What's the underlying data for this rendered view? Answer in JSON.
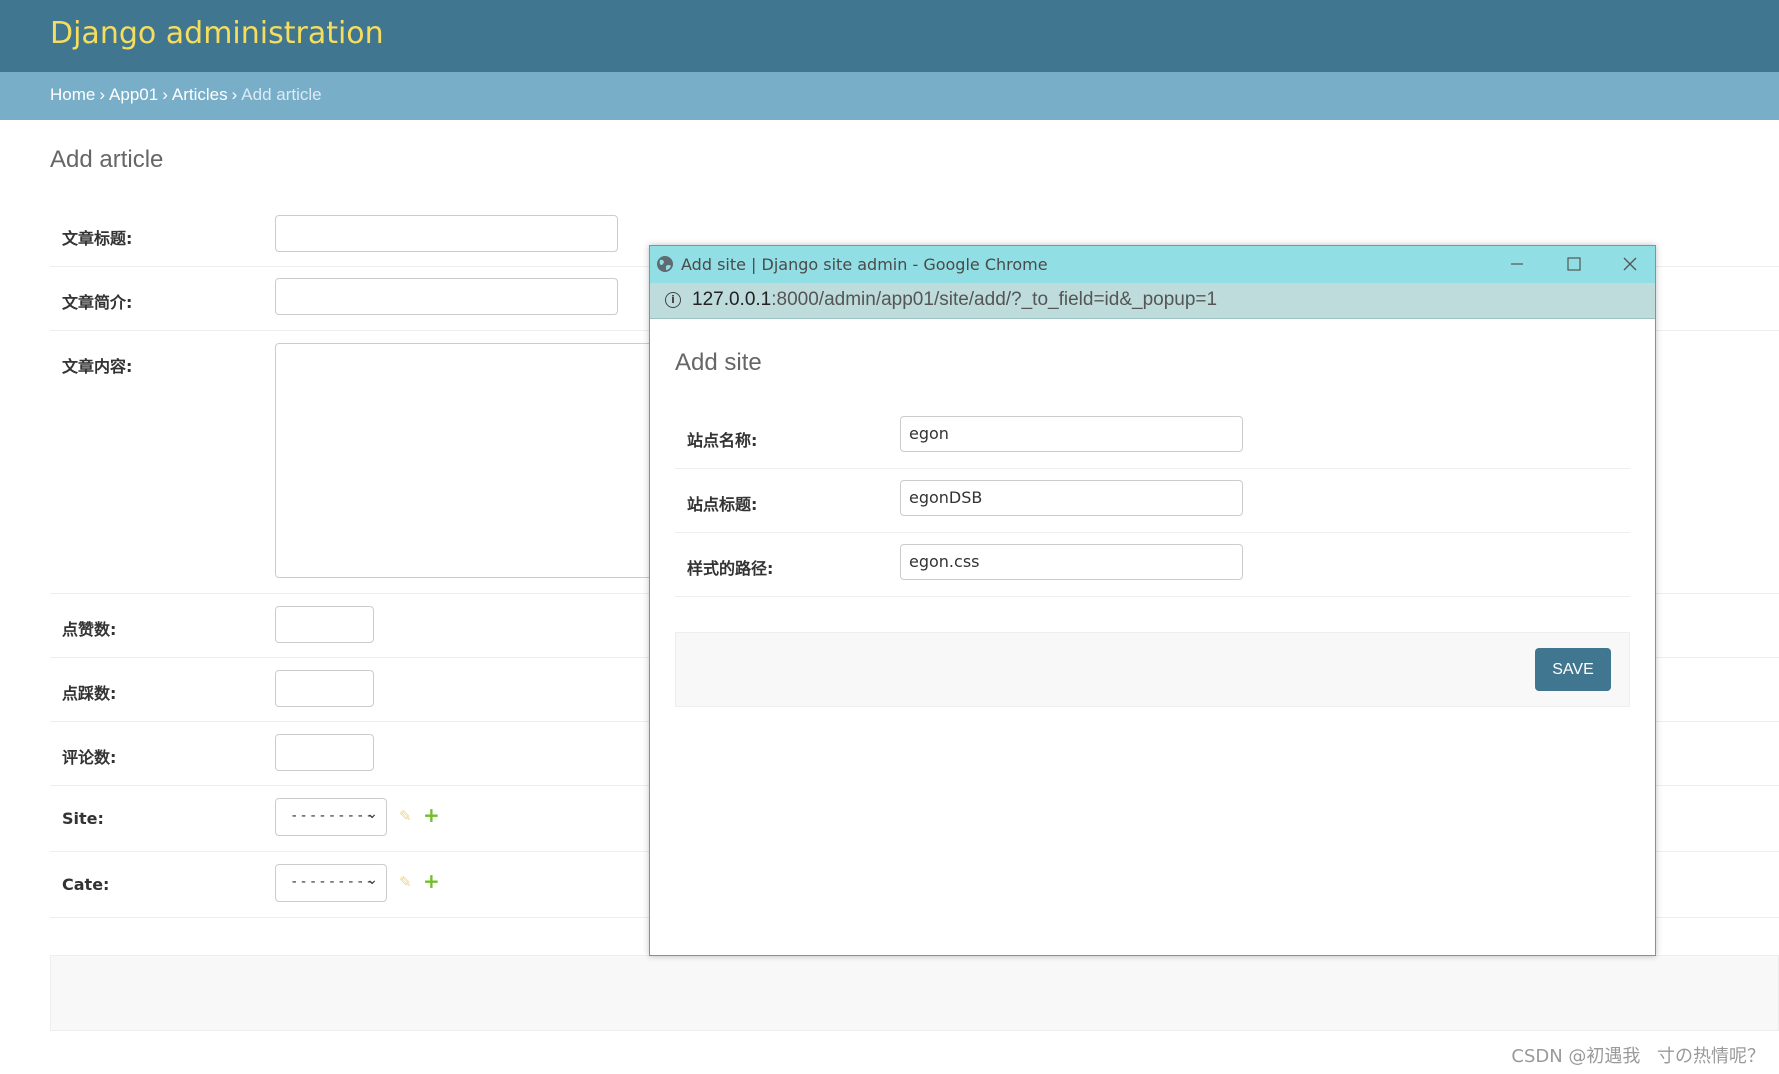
{
  "header": {
    "brand": "Django administration"
  },
  "breadcrumbs": {
    "home": "Home",
    "app": "App01",
    "model": "Articles",
    "current": "Add article",
    "separator": "›"
  },
  "main": {
    "title": "Add article",
    "fields": {
      "title_label": "文章标题:",
      "intro_label": "文章简介:",
      "content_label": "文章内容:",
      "likes_label": "点赞数:",
      "dislikes_label": "点踩数:",
      "comments_label": "评论数:",
      "site_label": "Site:",
      "cate_label": "Cate:"
    },
    "site_select": {
      "selected": "---------"
    },
    "cate_select": {
      "selected": "---------"
    }
  },
  "popup": {
    "window_title": "Add site | Django site admin - Google Chrome",
    "url_host": "127.0.0.1",
    "url_rest": ":8000/admin/app01/site/add/?_to_field=id&_popup=1",
    "title": "Add site",
    "fields": [
      {
        "label": "站点名称:",
        "value": "egon"
      },
      {
        "label": "站点标题:",
        "value": "egonDSB"
      },
      {
        "label": "样式的路径:",
        "value": "egon.css"
      }
    ],
    "save_label": "SAVE"
  },
  "watermark": "CSDN @初遇我ㅤ寸の热情呢？",
  "colors": {
    "header_bg": "#417690",
    "brand": "#f5dd5d",
    "breadcrumbs_bg": "#79aec8",
    "titlebar_bg": "#91dfe4",
    "addressbar_bg": "#bedcdc",
    "save_button": "#417690",
    "add_icon": "#70bf2b",
    "change_icon": "#efd48a"
  },
  "icons": {
    "change": "pencil-icon",
    "add": "plus-icon",
    "browser": "globe-icon",
    "security": "info-icon"
  }
}
